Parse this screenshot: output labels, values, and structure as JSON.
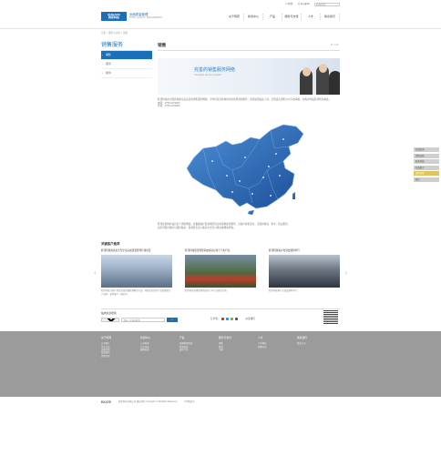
{
  "topbar": {
    "links": [
      "中文",
      "English"
    ],
    "search_placeholder": "站内搜索"
  },
  "header": {
    "logo_line1": "HUIBANG",
    "logo_line2": "辉邦科技",
    "brand": "全面质量管理",
    "brand_sub": "TOTAL QUALITY MANAGEMENT",
    "nav": [
      "关于辉邦",
      "新闻中心",
      "产品",
      "服务与支持",
      "人才",
      "联系我们"
    ]
  },
  "breadcrumb": "首页 > 服务与支持 > 销售",
  "side": {
    "title": "销售服务",
    "items": [
      "销售",
      "服务",
      "服务"
    ]
  },
  "main": {
    "title": "销售",
    "fontsize_label": "A⁺ A A⁻",
    "banner_title": "完善的销售服务网络",
    "banner_sub": "Complete service network",
    "intro": [
      "辉邦科技在全国各地建立起完善的销售服务网络，全年持续为各地用户提供周到的服务，营销总部设在上海，全国设有销售分公司/办事处，在各省均设有销售办事处。",
      "电话：0755-2270000",
      "传真：0755-2270000"
    ],
    "map_note": [
      "辉邦在国内外设有多个销售网络，并根据客户及各地区的实际需求提供服务，为客户提供及时、全面的售前、售中、售后服务。",
      "如有问题可随时与我们联系，各地区负责人联系方式可以通过本网站查询。"
    ]
  },
  "cases": {
    "title": "关键客户推荐",
    "items": [
      {
        "title": "辉邦科技协助某大型企业完成质量管理升级项目",
        "desc": "辉邦科技为客户提供全面质量管理解决方案，帮助企业提升产品质量和生产效率，获得客户一致好评。"
      },
      {
        "title": "辉邦科技质量管理系统成功应用于汽车行业",
        "desc": "辉邦科技质量管理系统在汽车行业成功应用。"
      },
      {
        "title": "辉邦科技客户交流会顺利举行",
        "desc": "辉邦科技客户交流会顺利举行。"
      }
    ]
  },
  "site_search": {
    "label": "站内信息搜索",
    "select_value": "全部",
    "placeholder": "请输入关键词搜索",
    "button": "搜索",
    "share_label": "分享到：",
    "follow_label": "关注我们"
  },
  "footer": {
    "columns": [
      {
        "title": "关于辉邦",
        "items": [
          "公司简介",
          "企业文化",
          "发展历程",
          "组织架构",
          "资质荣誉"
        ]
      },
      {
        "title": "新闻中心",
        "items": [
          "公司新闻",
          "行业动态",
          "媒体报道"
        ]
      },
      {
        "title": "产品",
        "items": [
          "质量管理系统",
          "检测设备",
          "软件产品"
        ]
      },
      {
        "title": "服务与支持",
        "items": [
          "销售",
          "服务",
          "下载"
        ]
      },
      {
        "title": "人才",
        "items": [
          "人才理念",
          "招聘信息"
        ]
      },
      {
        "title": "联系我们",
        "items": [
          "联系方式"
        ]
      }
    ],
    "watermark": "鸿益康游戏坊",
    "copy_logo": "BOZE",
    "copyright": "辉邦科技有限公司 版权所有 Copyright © All Rights Reserved",
    "icp": "ICP备案号"
  },
  "rfloat": [
    "在线咨询",
    "销售热线",
    "服务热线",
    "在线留言",
    "返回顶部",
    "微信"
  ]
}
